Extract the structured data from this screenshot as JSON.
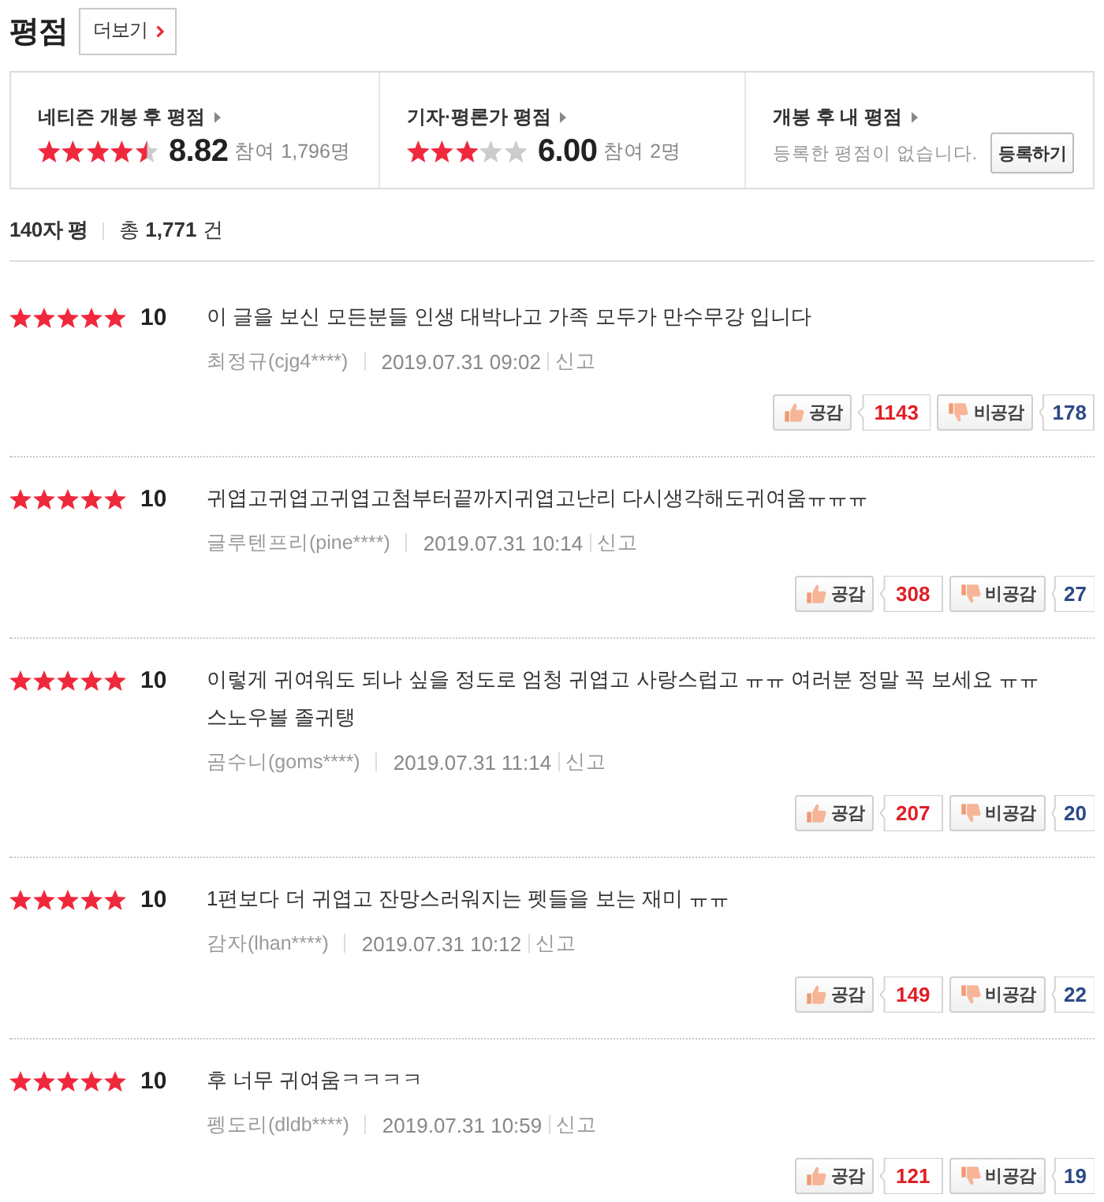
{
  "header": {
    "title": "평점",
    "more_button": "더보기"
  },
  "summary": [
    {
      "kind": "score",
      "title": "네티즌 개봉 후 평점",
      "stars": 4.5,
      "score": "8.82",
      "participants": "참여 1,796명"
    },
    {
      "kind": "score",
      "title": "기자·평론가 평점",
      "stars": 3,
      "score": "6.00",
      "participants": "참여 2명"
    },
    {
      "kind": "mine",
      "title": "개봉 후 내 평점",
      "message": "등록한 평점이 없습니다.",
      "button": "등록하기"
    }
  ],
  "review_list": {
    "title": "140자 평",
    "total": "총 **1,771** 건"
  },
  "reviews": [
    {
      "stars": 5,
      "score": "10",
      "text": "이 글을 보신 모든분들 인생 대박나고 가족 모두가 만수무강 입니다",
      "author": "최정규(cjg4****)",
      "date": "2019.07.31 09:02",
      "report": "신고",
      "like_label": "공감",
      "likes": "1143",
      "dislike_label": "비공감",
      "dislikes": "178"
    },
    {
      "stars": 5,
      "score": "10",
      "text": "귀엽고귀엽고귀엽고첨부터끝까지귀엽고난리 다시생각해도귀여움ㅠㅠㅠ",
      "author": "글루텐프리(pine****)",
      "date": "2019.07.31 10:14",
      "report": "신고",
      "like_label": "공감",
      "likes": "308",
      "dislike_label": "비공감",
      "dislikes": "27"
    },
    {
      "stars": 5,
      "score": "10",
      "text": "이렇게 귀여워도 되나 싶을 정도로 엄청 귀엽고 사랑스럽고 ㅠㅠ 여러분 정말 꼭 보세요 ㅠㅠ 스노우볼 졸귀탱",
      "author": "곰수니(goms****)",
      "date": "2019.07.31 11:14",
      "report": "신고",
      "like_label": "공감",
      "likes": "207",
      "dislike_label": "비공감",
      "dislikes": "20"
    },
    {
      "stars": 5,
      "score": "10",
      "text": "1편보다 더 귀엽고 잔망스러워지는 펫들을 보는 재미 ㅠㅠ",
      "author": "감자(lhan****)",
      "date": "2019.07.31 10:12",
      "report": "신고",
      "like_label": "공감",
      "likes": "149",
      "dislike_label": "비공감",
      "dislikes": "22"
    },
    {
      "stars": 5,
      "score": "10",
      "text": "후 너무 귀여움ㅋㅋㅋㅋ",
      "author": "펭도리(dldb****)",
      "date": "2019.07.31 10:59",
      "report": "신고",
      "like_label": "공감",
      "likes": "121",
      "dislike_label": "비공감",
      "dislikes": "19"
    }
  ]
}
